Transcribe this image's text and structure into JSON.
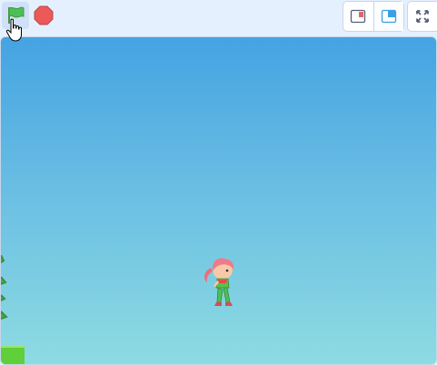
{
  "toolbar": {
    "start_icon": "green-flag-icon",
    "stop_icon": "stop-sign-icon",
    "small_stage_icon": "small-stage-icon",
    "normal_stage_icon": "normal-stage-icon",
    "fullscreen_icon": "fullscreen-icon"
  },
  "stage": {
    "backdrop": "sky-gradient",
    "sprite_name": "girl-sprite",
    "colors": {
      "sky_top": "#45a3e2",
      "sky_bottom": "#8ddbe2",
      "flag_green": "#4cbf56",
      "stop_red": "#ec5959",
      "accent_blue": "#3aa0e4"
    }
  },
  "pointer": {
    "icon": "hand-pointer-icon"
  }
}
